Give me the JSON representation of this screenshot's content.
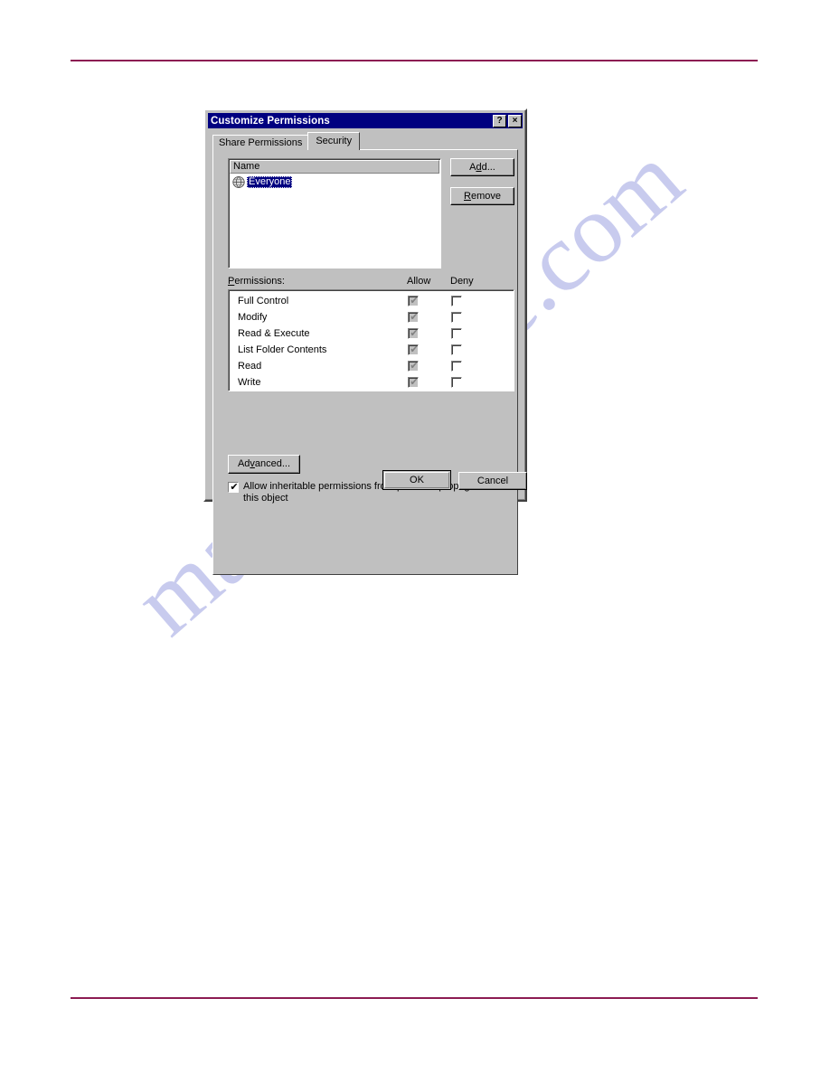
{
  "page": {
    "rule_color": "#8c1b52",
    "watermark": "manualshive.com"
  },
  "dialog": {
    "title": "Customize Permissions",
    "titlebar_buttons": [
      {
        "name": "help-button",
        "label": "?"
      },
      {
        "name": "close-button",
        "label": "×"
      }
    ],
    "tabs": [
      {
        "label": "Share Permissions",
        "active": false
      },
      {
        "label": "Security",
        "active": true
      }
    ],
    "name_list": {
      "header": "Name",
      "rows": [
        {
          "label": "Everyone",
          "icon": "globe-icon",
          "selected": true
        }
      ]
    },
    "buttons": {
      "add": "Add...",
      "add_accel": "d",
      "remove": "Remove",
      "remove_accel": "R",
      "advanced": "Advanced...",
      "advanced_accel": "v",
      "ok": "OK",
      "cancel": "Cancel"
    },
    "permissions": {
      "label": "Permissions:",
      "label_accel": "P",
      "allow_header": "Allow",
      "deny_header": "Deny",
      "rows": [
        {
          "name": "Full Control",
          "allow": true,
          "deny": false,
          "allow_dimmed": true
        },
        {
          "name": "Modify",
          "allow": true,
          "deny": false,
          "allow_dimmed": true
        },
        {
          "name": "Read & Execute",
          "allow": true,
          "deny": false,
          "allow_dimmed": true
        },
        {
          "name": "List Folder Contents",
          "allow": true,
          "deny": false,
          "allow_dimmed": true
        },
        {
          "name": "Read",
          "allow": true,
          "deny": false,
          "allow_dimmed": true
        },
        {
          "name": "Write",
          "allow": true,
          "deny": false,
          "allow_dimmed": true
        }
      ]
    },
    "inherit": {
      "checked": true,
      "text": "Allow inheritable permissions from parent to propagate to this object"
    },
    "colors": {
      "titlebar": "#000080",
      "face": "#c0c0c0",
      "selection": "#000080"
    }
  }
}
